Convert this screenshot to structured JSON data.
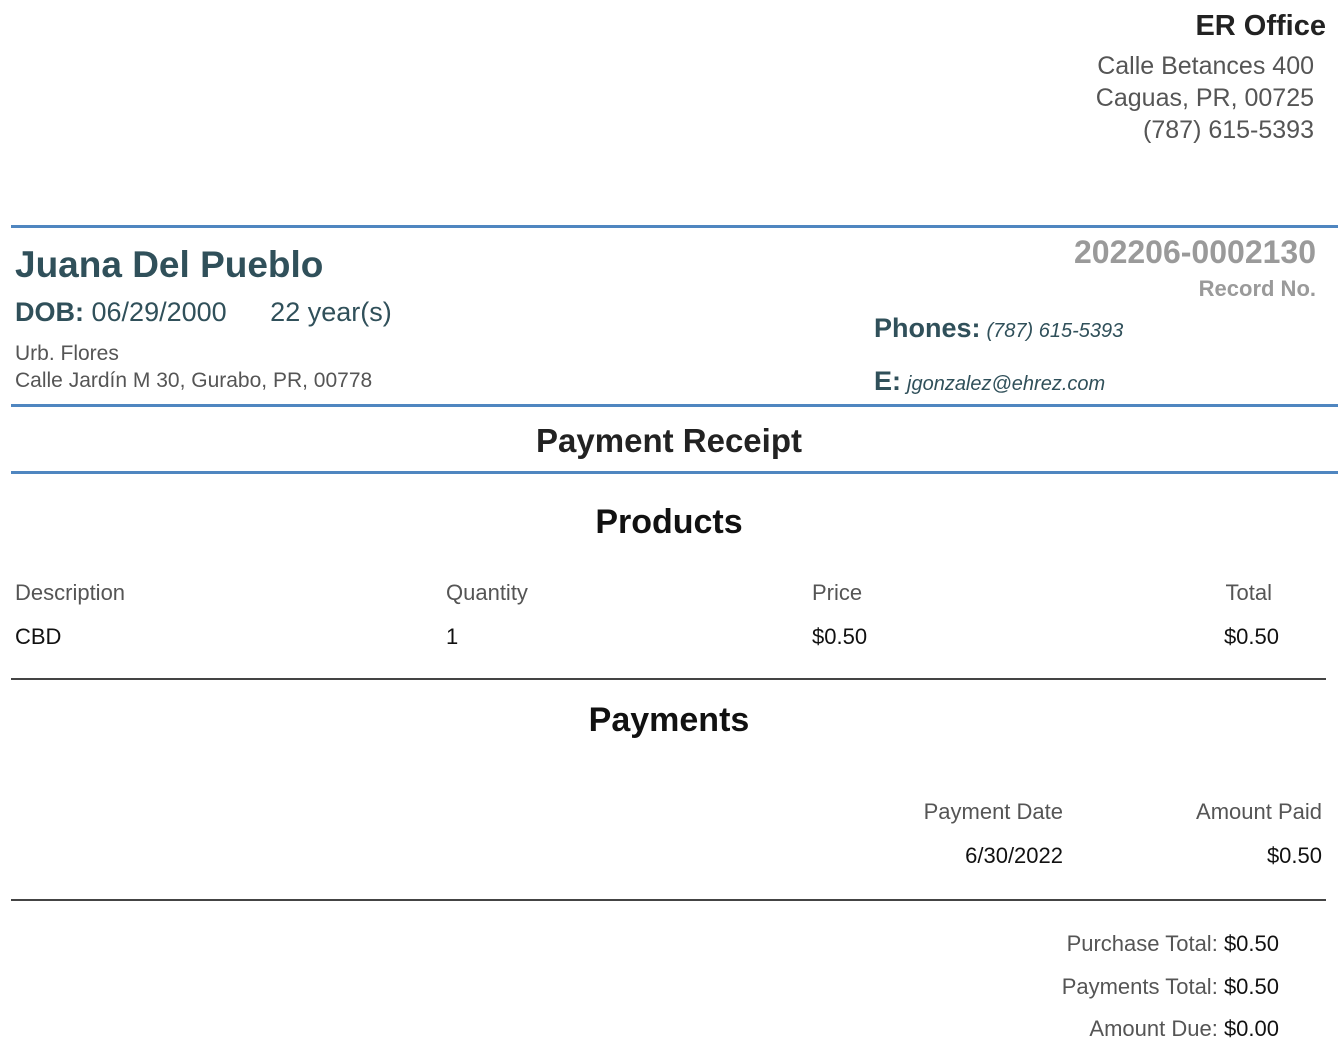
{
  "office": {
    "name": "ER Office",
    "address_line1": "Calle Betances 400",
    "address_line2": "Caguas, PR, 00725",
    "phone": "(787) 615-5393"
  },
  "patient": {
    "name": "Juana Del Pueblo",
    "dob_label": "DOB:",
    "dob": "06/29/2000",
    "age": "22 year(s)",
    "address_line1": "Urb. Flores",
    "address_line2": "Calle Jardín M 30, Gurabo, PR, 00778",
    "record_number": "202206-0002130",
    "record_label": "Record No.",
    "phones_label": "Phones:",
    "phone": "(787) 615-5393",
    "email_label": "E:",
    "email": "jgonzalez@ehrez.com"
  },
  "document_title": "Payment Receipt",
  "products": {
    "title": "Products",
    "headers": [
      "Description",
      "Quantity",
      "Price",
      "Total"
    ],
    "rows": [
      [
        "CBD",
        "1",
        "$0.50",
        "$0.50"
      ]
    ]
  },
  "payments": {
    "title": "Payments",
    "headers": [
      "Payment Date",
      "Amount Paid"
    ],
    "rows": [
      [
        "6/30/2022",
        "$0.50"
      ]
    ]
  },
  "totals": [
    {
      "label": "Purchase Total:",
      "value": "$0.50"
    },
    {
      "label": "Payments Total:",
      "value": "$0.50"
    },
    {
      "label": "Amount Due:",
      "value": "$0.00"
    }
  ],
  "colors": {
    "rule_accent": "#4f86c0",
    "patient_text": "#30505a",
    "record_gray": "#9a9a9a"
  }
}
